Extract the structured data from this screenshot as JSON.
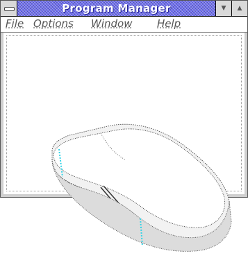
{
  "window": {
    "title": "Program Manager"
  },
  "menu": {
    "items": [
      "File",
      "Options",
      "Window",
      "Help"
    ]
  },
  "icons": {
    "system_menu": "control-menu-bar-icon",
    "minimize": "down-triangle-icon",
    "maximize": "up-triangle-icon",
    "mouse": "computer-mouse-illustration"
  }
}
